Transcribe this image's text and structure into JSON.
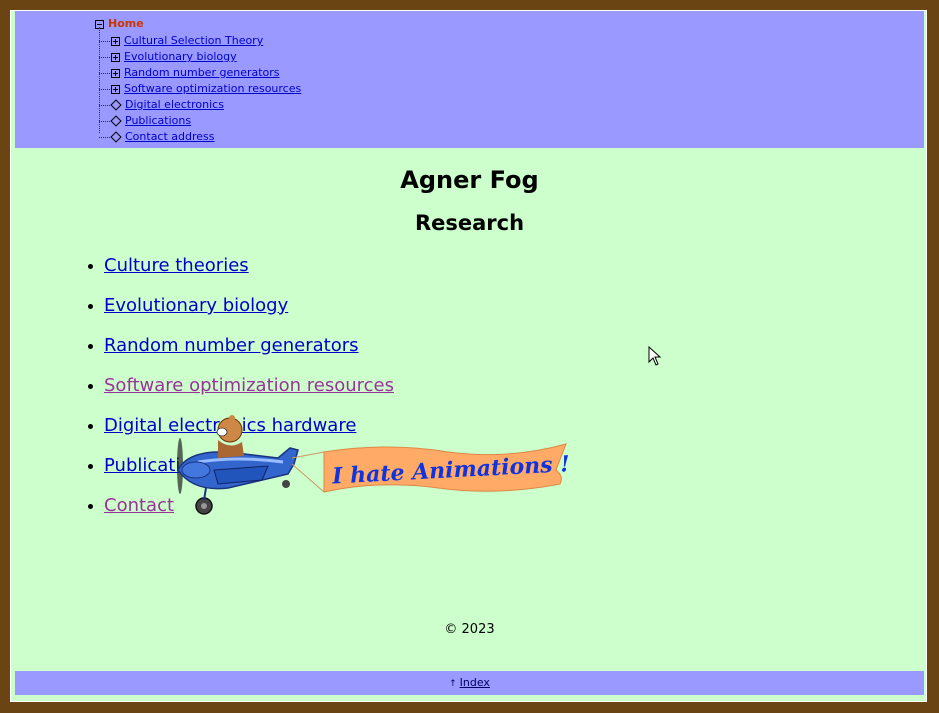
{
  "menu": {
    "root_label": "Home",
    "items": [
      {
        "label": "Cultural Selection Theory",
        "icon": "plus-box-icon"
      },
      {
        "label": "Evolutionary biology",
        "icon": "plus-box-icon"
      },
      {
        "label": "Random number generators",
        "icon": "plus-box-icon"
      },
      {
        "label": "Software optimization resources",
        "icon": "plus-box-icon"
      },
      {
        "label": "Digital electronics",
        "icon": "diamond-bullet-icon"
      },
      {
        "label": "Publications",
        "icon": "diamond-bullet-icon"
      },
      {
        "label": "Contact address",
        "icon": "diamond-bullet-icon"
      }
    ]
  },
  "page": {
    "title": "Agner Fog",
    "subtitle": "Research"
  },
  "research": {
    "items": [
      {
        "label": "Culture theories",
        "visited": false
      },
      {
        "label": "Evolutionary biology",
        "visited": false
      },
      {
        "label": "Random number generators",
        "visited": false
      },
      {
        "label": "Software optimization resources",
        "visited": true
      },
      {
        "label": "Digital electronics hardware",
        "visited": false
      },
      {
        "label": "Publications",
        "visited": false
      },
      {
        "label": "Contact",
        "visited": true
      }
    ]
  },
  "animation": {
    "banner_text": "I hate Animations !"
  },
  "footer": {
    "copyright": "© 2023",
    "index_label": "Index"
  },
  "colors": {
    "page_border": "#6b4414",
    "content_bg": "#ccffcc",
    "menu_bg": "#9999ff",
    "link": "#0000cc",
    "visited_link": "#993399",
    "home_label": "#cc3300",
    "banner": "#ffaa66"
  }
}
